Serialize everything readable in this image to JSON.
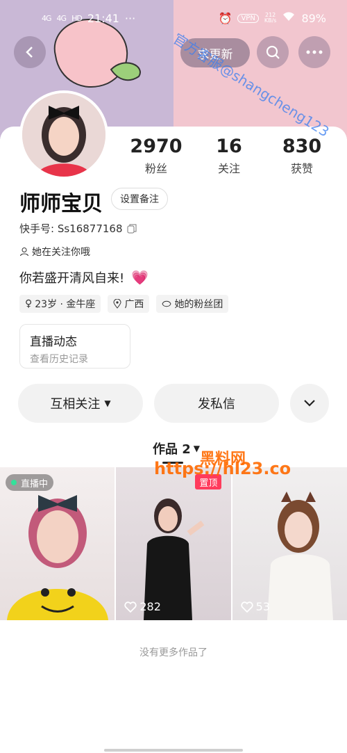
{
  "status_bar": {
    "signal1": "4G",
    "signal2": "4G",
    "hd": "HD",
    "time": "21:41",
    "dots": "···",
    "vpn": "VPN",
    "speed": "212",
    "speed_unit": "KB/s",
    "battery": "89%"
  },
  "header": {
    "follow_back_label": "求更新"
  },
  "profile": {
    "name": "师师宝贝",
    "remark_button": "设置备注",
    "id_label": "快手号: Ss16877168",
    "follows_you": "她在关注你哦",
    "bio": "你若盛开清风自来!",
    "tags": [
      "23岁 · 金牛座",
      "广西",
      "她的粉丝团"
    ]
  },
  "stats": [
    {
      "value": "2970",
      "label": "粉丝"
    },
    {
      "value": "16",
      "label": "关注"
    },
    {
      "value": "830",
      "label": "获赞"
    }
  ],
  "live_box": {
    "title": "直播动态",
    "subtitle": "查看历史记录"
  },
  "actions": {
    "mutual": "互相关注",
    "dm": "发私信"
  },
  "works": {
    "tab_label": "作品 2"
  },
  "grid": [
    {
      "badge": "直播中"
    },
    {
      "badge": "置顶",
      "likes": "282"
    },
    {
      "likes": "53"
    }
  ],
  "footer": {
    "no_more": "没有更多作品了"
  },
  "watermarks": {
    "w1": "官方客服@shangcheng123",
    "w2": "黑料网",
    "w3": "https://hl23.co"
  },
  "colors": {
    "accent_pink": "#ff3b5c",
    "live_green": "#33e19a",
    "watermark_blue": "#3b7ff0",
    "watermark_orange": "#ff6a00"
  }
}
